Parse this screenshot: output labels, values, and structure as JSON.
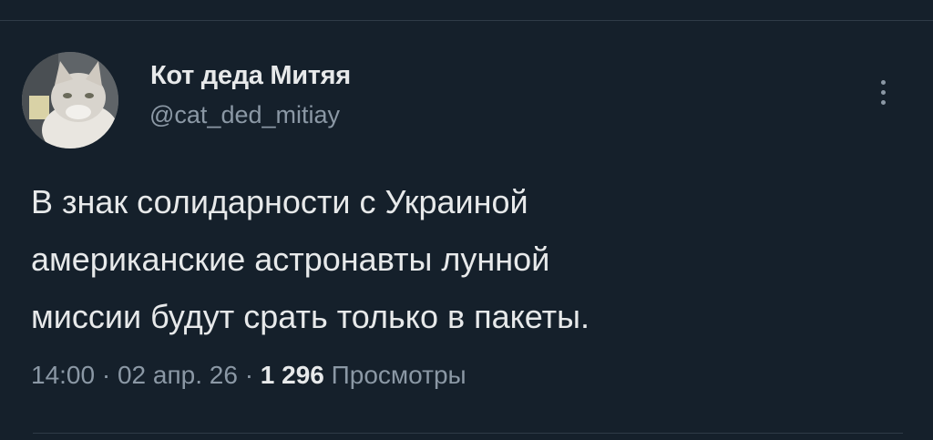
{
  "author": {
    "display_name": "Кот деда Митяя",
    "handle": "@cat_ded_mitiay",
    "avatar_icon": "cat-avatar"
  },
  "tweet": {
    "text_lines": [
      "В знак солидарности с Украиной",
      "американские астронавты лунной",
      "миссии будут срать только в пакеты."
    ]
  },
  "meta": {
    "time": "14:00",
    "separator": "·",
    "date": "02 апр. 26",
    "views_count": "1 296",
    "views_label": "Просмотры"
  },
  "icons": {
    "more": "more-vertical-icon"
  },
  "colors": {
    "background": "#15202b",
    "primary_text": "#e7e9ea",
    "secondary_text": "#8b98a5",
    "divider": "#2f3b47"
  }
}
